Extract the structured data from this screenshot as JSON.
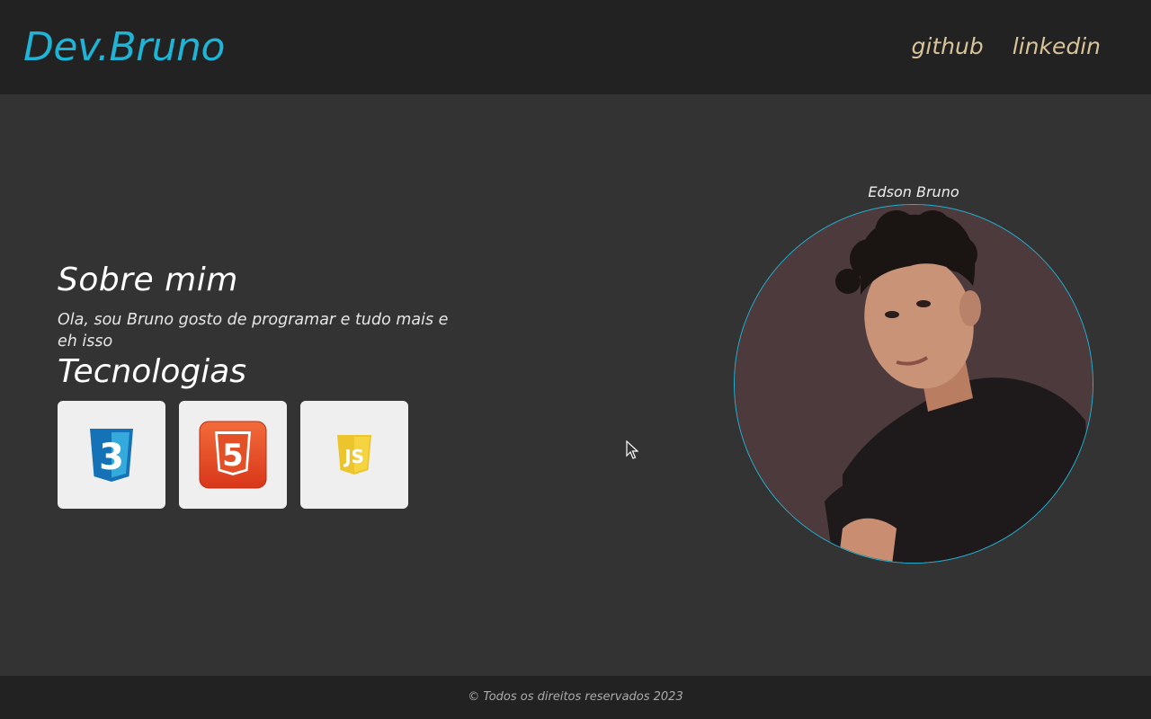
{
  "header": {
    "logo": "Dev.Bruno",
    "nav": [
      {
        "label": "github"
      },
      {
        "label": "linkedin"
      }
    ]
  },
  "about": {
    "title": "Sobre mim",
    "text": "Ola, sou Bruno gosto de programar e tudo mais e eh isso",
    "tech_title": "Tecnologias",
    "techs": [
      {
        "icon": "css3-icon",
        "label": "3"
      },
      {
        "icon": "html5-icon",
        "label": "5"
      },
      {
        "icon": "javascript-icon",
        "label": "JS"
      }
    ]
  },
  "profile": {
    "name": "Edson Bruno",
    "photo": "profile-photo"
  },
  "footer": {
    "text": "© Todos os direitos reservados 2023"
  },
  "colors": {
    "accent": "#1fb4d6",
    "nav": "#d9c49a",
    "background": "#333333",
    "bar": "#222222"
  }
}
